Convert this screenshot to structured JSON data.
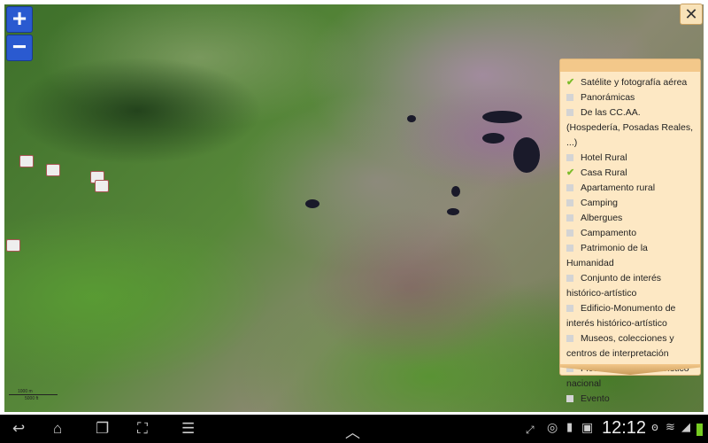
{
  "map": {
    "zoom_in": "+",
    "zoom_out": "−",
    "close": "✕",
    "scale": {
      "metric": "1000 m",
      "imperial": "5000 ft"
    }
  },
  "layers": [
    {
      "label": "Satélite y fotografía aérea",
      "checked": true
    },
    {
      "label": "Panorámicas",
      "checked": false
    },
    {
      "label": "De las CC.AA. (Hospedería, Posadas Reales, ...)",
      "checked": false
    },
    {
      "label": "Hotel Rural",
      "checked": false
    },
    {
      "label": "Casa Rural",
      "checked": true
    },
    {
      "label": "Apartamento rural",
      "checked": false
    },
    {
      "label": "Camping",
      "checked": false
    },
    {
      "label": "Albergues",
      "checked": false
    },
    {
      "label": "Campamento",
      "checked": false
    },
    {
      "label": "Patrimonio de la Humanidad",
      "checked": false
    },
    {
      "label": "Conjunto de interés histórico-artístico",
      "checked": false
    },
    {
      "label": "Edificio-Monumento de interés histórico-artístico",
      "checked": false
    },
    {
      "label": "Museos, colecciones y centros de interpretación",
      "checked": false
    },
    {
      "label": "Fiestas de interés turístico nacional",
      "checked": false
    },
    {
      "label": "Evento",
      "checked": false
    }
  ],
  "status": {
    "time": "12:12"
  }
}
